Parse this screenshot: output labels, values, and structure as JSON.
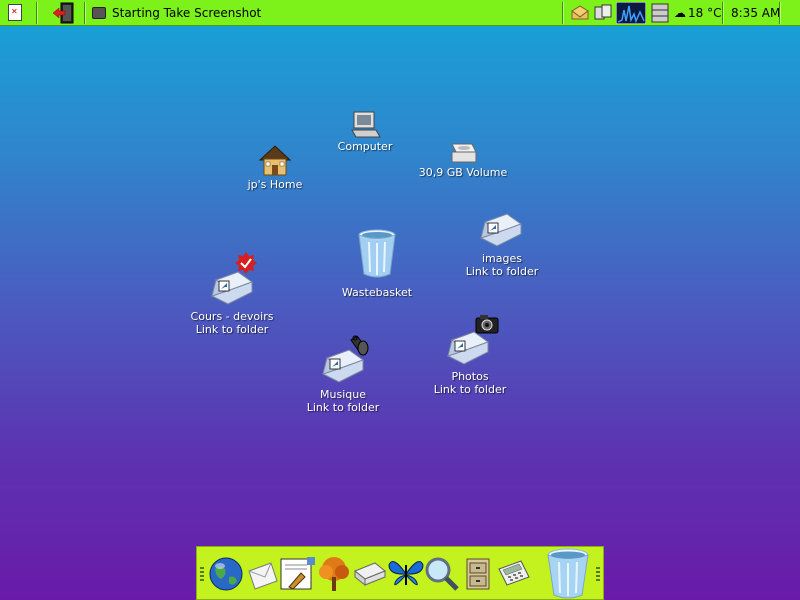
{
  "top_panel": {
    "task_title": "Starting Take Screenshot",
    "weather": "18 °C",
    "clock": "8:35 AM"
  },
  "desktop": {
    "icons": [
      {
        "name": "Computer",
        "sub": ""
      },
      {
        "name": "jp's Home",
        "sub": ""
      },
      {
        "name": "30,9 GB Volume",
        "sub": ""
      },
      {
        "name": "images",
        "sub": "Link to folder"
      },
      {
        "name": "Wastebasket",
        "sub": ""
      },
      {
        "name": "Cours - devoirs",
        "sub": "Link to folder"
      },
      {
        "name": "Photos",
        "sub": "Link to folder"
      },
      {
        "name": "Musique",
        "sub": "Link to folder"
      }
    ]
  },
  "dock": {
    "items": [
      "globe-icon",
      "mail-icon",
      "writer-icon",
      "tree-icon",
      "scanner-icon",
      "butterfly-icon",
      "magnifier-icon",
      "cabinet-icon",
      "calculator-icon",
      "wastebasket-icon"
    ]
  },
  "colors": {
    "panel": "#7cf21a",
    "dock": "#c4f21e",
    "desktop_top": "#14a4d8",
    "desktop_bottom": "#6a1aa8"
  }
}
